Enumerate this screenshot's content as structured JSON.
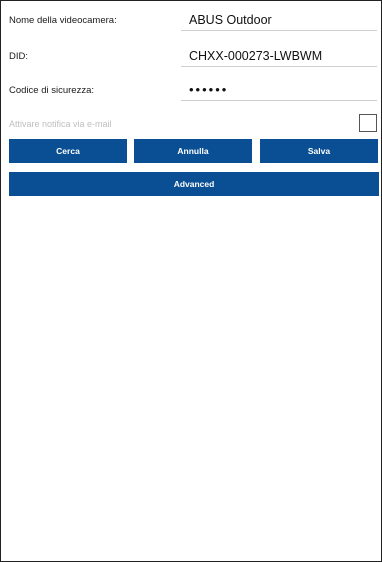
{
  "form": {
    "camera_name": {
      "label": "Nome della videocamera:",
      "value": "ABUS Outdoor"
    },
    "did": {
      "label": "DID:",
      "value": "CHXX-000273-LWBWM"
    },
    "security_code": {
      "label": "Codice di sicurezza:",
      "value": "••••••"
    },
    "email_notification": {
      "label": "Attivare notifica via e-mail",
      "checked": false
    }
  },
  "buttons": {
    "search": "Cerca",
    "cancel": "Annulla",
    "save": "Salva",
    "advanced": "Advanced"
  },
  "colors": {
    "button_bg": "#0a4f93",
    "button_text": "#ffffff",
    "disabled_label": "#bfbfbf"
  }
}
